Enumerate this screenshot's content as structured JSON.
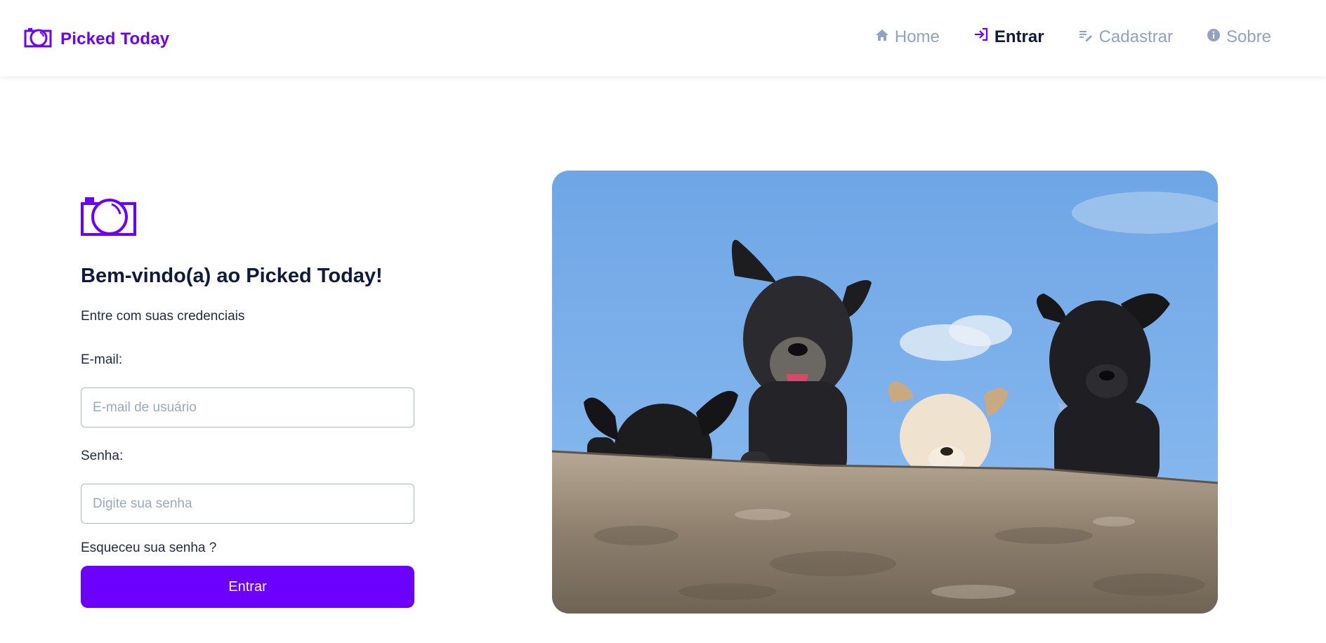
{
  "brand": {
    "name": "Picked Today",
    "icon": "camera-icon",
    "color": "#6c00ff"
  },
  "nav": {
    "items": [
      {
        "label": "Home",
        "icon": "home-icon",
        "active": false
      },
      {
        "label": "Entrar",
        "icon": "login-icon",
        "active": true
      },
      {
        "label": "Cadastrar",
        "icon": "edit-list-icon",
        "active": false
      },
      {
        "label": "Sobre",
        "icon": "info-icon",
        "active": false
      }
    ]
  },
  "login": {
    "title": "Bem-vindo(a) ao Picked Today!",
    "subtitle": "Entre com suas credenciais",
    "email_label": "E-mail:",
    "email_placeholder": "E-mail de usuário",
    "email_value": "",
    "password_label": "Senha:",
    "password_placeholder": "Digite sua senha",
    "password_value": "",
    "forgot_label": "Esqueceu sua senha ?",
    "submit_label": "Entrar"
  },
  "photo": {
    "subject": "four dogs peeking over a stone wall under a blue sky"
  },
  "colors": {
    "accent": "#6c00ff",
    "text_dark": "#0f1b3d",
    "nav_muted": "#93a3bf",
    "input_border": "#a8b6cc"
  }
}
